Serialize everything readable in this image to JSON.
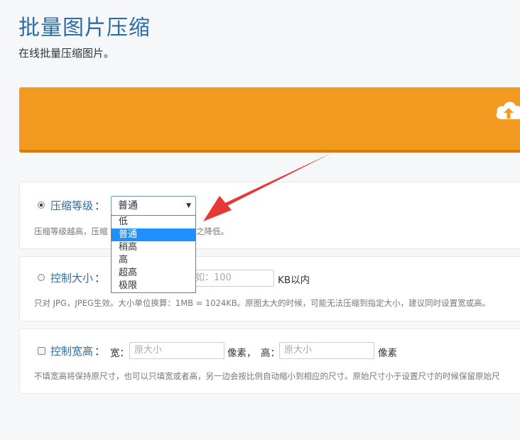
{
  "header": {
    "title": "批量图片压缩",
    "subtitle": "在线批量压缩图片。"
  },
  "colors": {
    "accent": "#2d6da3",
    "upload_bg": "#f39a21",
    "selection": "#1e90ff"
  },
  "compress_level": {
    "label": "压缩等级",
    "colon": "：",
    "selected": "普通",
    "hint": "压缩等级越高，压缩",
    "hint_tail": "之降低。",
    "options": [
      "低",
      "普通",
      "稍高",
      "高",
      "超高",
      "极限"
    ]
  },
  "size_limit": {
    "label": "控制大小",
    "colon": "：",
    "placeholder": "如：100",
    "unit": "KB以内",
    "hint": "只对 JPG，JPEG生效。大小单位换算：1MB = 1024KB。原图太大的时候，可能无法压缩到指定大小，建议同时设置宽或高。"
  },
  "dimensions": {
    "label": "控制宽高",
    "colon": "：",
    "width_label": "宽：",
    "width_placeholder": "原大小",
    "width_unit": "像素，",
    "height_label": "高：",
    "height_placeholder": "原大小",
    "height_unit": "像素",
    "hint": "不填宽高将保持原尺寸，也可以只填宽或者高，另一边会按比例自动缩小到相应的尺寸。原始尺寸小于设置尺寸的时候保留原始尺"
  }
}
